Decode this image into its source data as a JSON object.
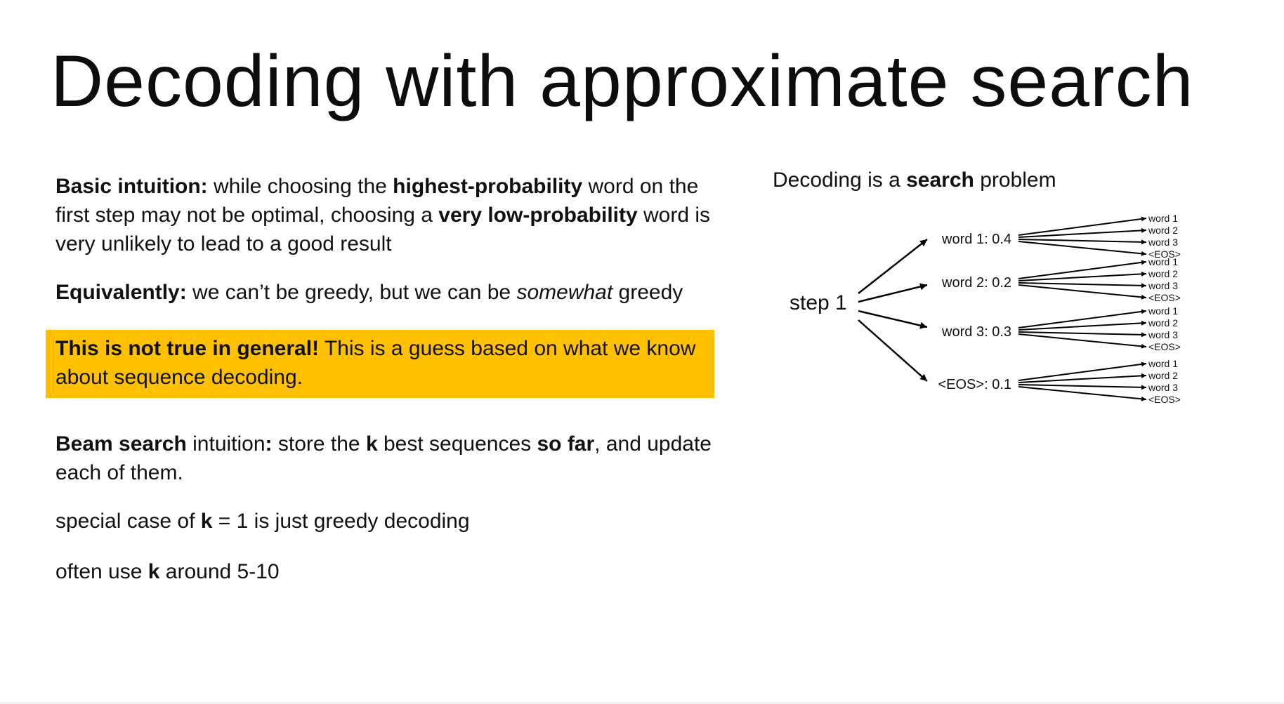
{
  "slide": {
    "title": "Decoding with approximate search",
    "basic_intuition": {
      "label": "Basic intuition:",
      "text1": " while choosing the ",
      "bold1": "highest-probability",
      "text2": " word on the first step may not be optimal, choosing a ",
      "bold2": "very low-probability",
      "text3": " word is very unlikely to lead to a good result"
    },
    "equivalently": {
      "label": "Equivalently:",
      "text1": " we can’t be greedy, but we can be ",
      "italic": "somewhat",
      "text2": " greedy"
    },
    "callout": {
      "bold": "This is not true in general!",
      "text": " This is a guess based on what we know about sequence decoding."
    },
    "beam": {
      "bold1": "Beam search",
      "text1": " intuition",
      "bold2": ":",
      "text2": " store the ",
      "bold3": "k",
      "text3": " best sequences ",
      "bold4": "so far",
      "text4": ", and update each of them."
    },
    "special_case": {
      "text1": "special case of ",
      "bold": "k",
      "text2": " = 1 is just greedy decoding"
    },
    "often_use": {
      "text1": "often use ",
      "bold": "k",
      "text2": " around 5-10"
    },
    "colors": {
      "callout_background": "#ffc000",
      "text": "#111111"
    }
  },
  "diagram": {
    "heading_text1": "Decoding is a ",
    "heading_bold": "search",
    "heading_text2": " problem",
    "root_label": "step 1",
    "branches": [
      {
        "label": "word 1: 0.4",
        "children": [
          "word 1",
          "word 2",
          "word 3",
          "<EOS>"
        ]
      },
      {
        "label": "word 2: 0.2",
        "children": [
          "word 1",
          "word 2",
          "word 3",
          "<EOS>"
        ]
      },
      {
        "label": "word 3: 0.3",
        "children": [
          "word 1",
          "word 2",
          "word 3",
          "<EOS>"
        ]
      },
      {
        "label": "<EOS>: 0.1",
        "children": [
          "word 1",
          "word 2",
          "word 3",
          "<EOS>"
        ]
      }
    ]
  }
}
